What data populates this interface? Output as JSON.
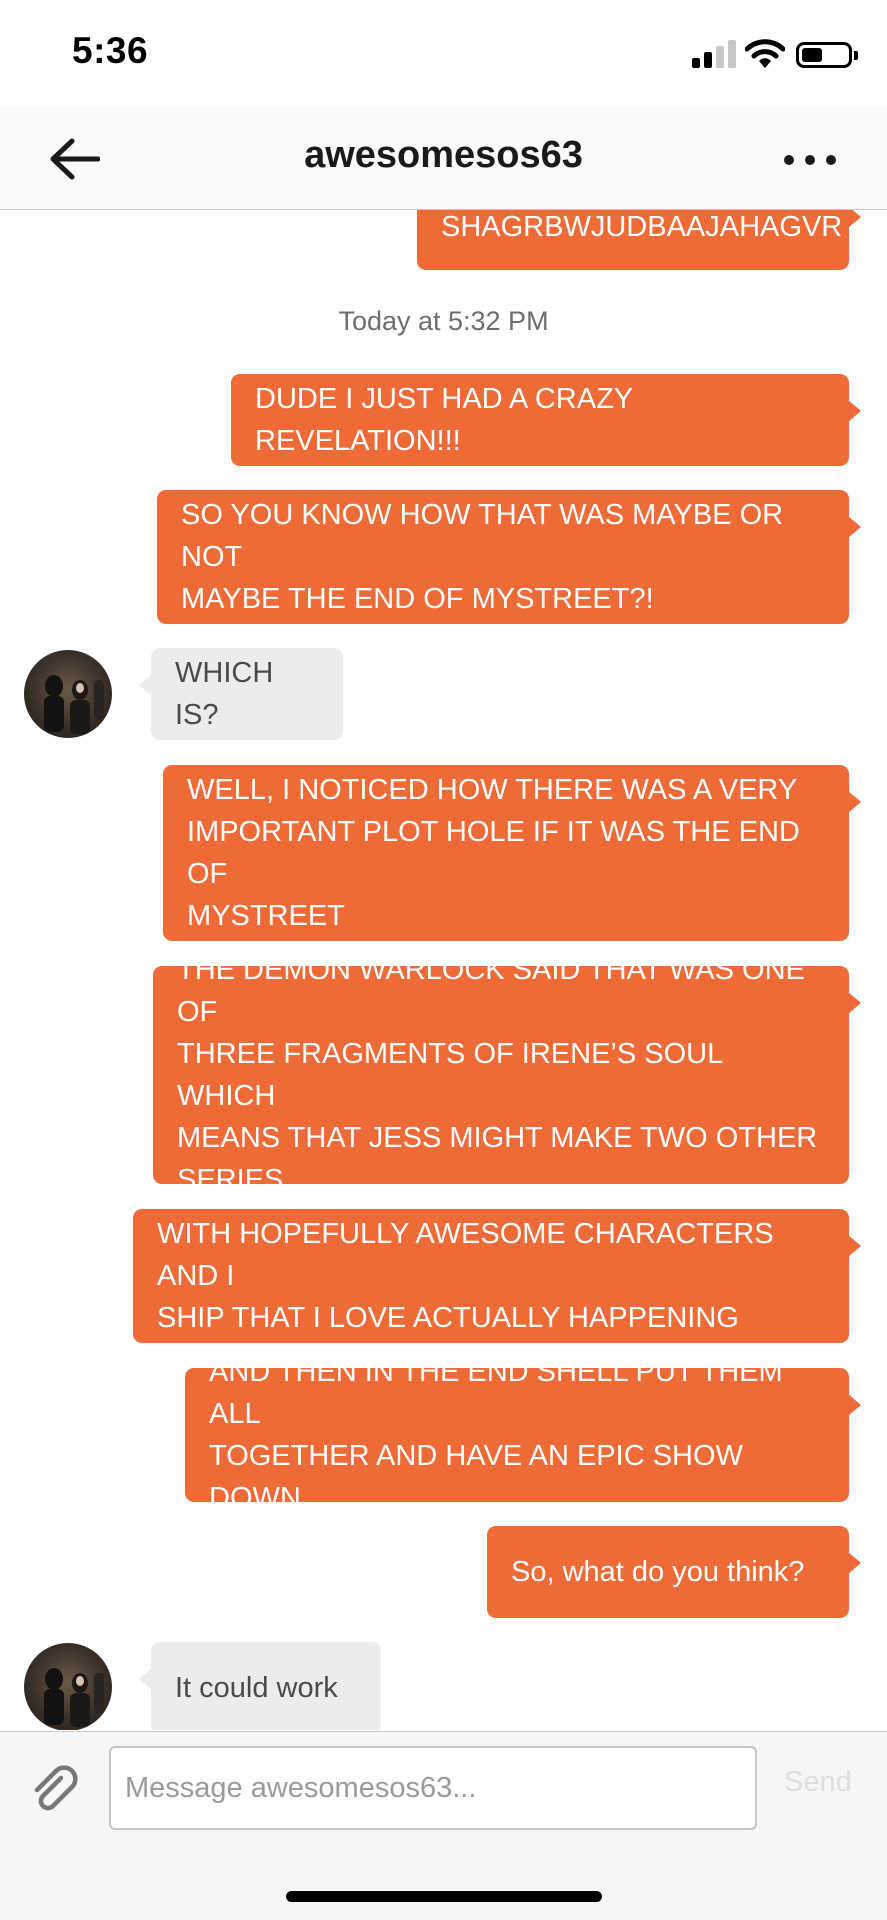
{
  "status_bar": {
    "time": "5:36",
    "signal_icon": "cellular-signal-icon",
    "wifi_icon": "wifi-icon",
    "battery_icon": "battery-icon",
    "battery_level": 0.45
  },
  "header": {
    "back_icon": "arrow-left-icon",
    "title": "awesomesos63",
    "more_icon": "ellipsis-icon"
  },
  "chat": {
    "timestamp": "Today at 5:32 PM",
    "messages": [
      {
        "from": "me",
        "lines": [
          "SHAGRBWJUDBAAJAHAGVR"
        ]
      },
      {
        "from": "me",
        "lines": [
          "DUDE I JUST HAD A CRAZY REVELATION!!!"
        ]
      },
      {
        "from": "me",
        "lines": [
          "SO YOU KNOW HOW THAT WAS MAYBE OR NOT",
          "MAYBE THE END OF MYSTREET?!"
        ]
      },
      {
        "from": "them",
        "lines": [
          "WHICH IS?"
        ]
      },
      {
        "from": "me",
        "lines": [
          "WELL, I NOTICED HOW THERE WAS A VERY",
          "IMPORTANT PLOT HOLE IF IT WAS THE END OF",
          "MYSTREET"
        ]
      },
      {
        "from": "me",
        "lines": [
          "THE DEMON WARLOCK SAID THAT WAS ONE OF",
          "THREE FRAGMENTS OF IRENE’S SOUL WHICH",
          "MEANS THAT JESS MIGHT MAKE TWO OTHER",
          "SERIES"
        ]
      },
      {
        "from": "me",
        "lines": [
          "WITH HOPEFULLY AWESOME CHARACTERS AND I",
          "SHIP THAT I LOVE ACTUALLY HAPPENING"
        ]
      },
      {
        "from": "me",
        "lines": [
          "AND THEN IN THE END SHELL PUT THEM ALL",
          "TOGETHER AND HAVE AN EPIC SHOW DOWN"
        ]
      },
      {
        "from": "me",
        "lines": [
          "So, what do you think?"
        ]
      },
      {
        "from": "them",
        "lines": [
          "It could work"
        ]
      }
    ]
  },
  "composer": {
    "attach_icon": "paperclip-icon",
    "placeholder": "Message awesomesos63...",
    "value": "",
    "send_label": "Send"
  },
  "colors": {
    "sent_bubble": "#ee6b37",
    "received_bubble": "#ececec",
    "sent_text": "#ffffff",
    "received_text": "#4a4a4a"
  }
}
